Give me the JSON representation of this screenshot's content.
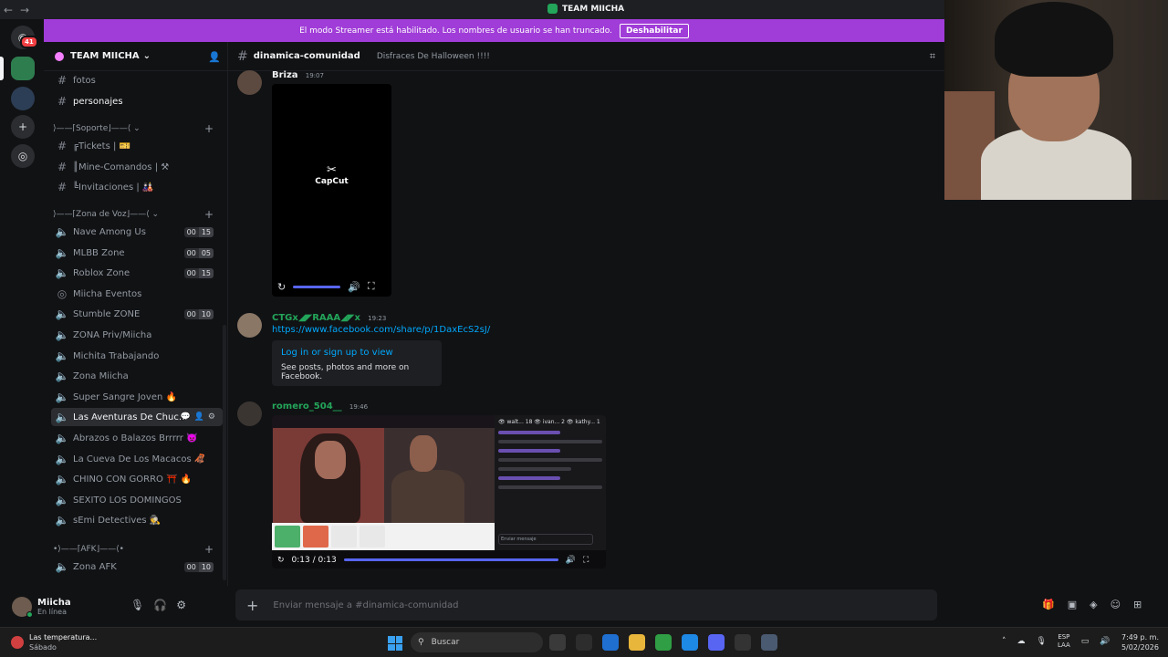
{
  "titlebar": {
    "title": "TEAM MIICHA",
    "back": "←",
    "forward": "→"
  },
  "rail": {
    "badge": "41"
  },
  "banner": {
    "text": "El modo Streamer está habilitado. Los nombres de usuario se han truncado.",
    "button": "Deshabilitar"
  },
  "guild": {
    "name": "TEAM MIICHA"
  },
  "channels": {
    "fotos": "fotos",
    "personajes": "personajes",
    "cat_soporte": "⟩——⌈Soporte⌋——⟨ ⌄",
    "tickets": "╔Tickets | 🎫",
    "mine": "║Mine-Comandos | ⚒",
    "invitaciones": "╚Invitaciones | 🎎",
    "cat_voz": "⟩——⌈Zona de Voz⌋——⟨ ⌄",
    "cat_afk": "•⟩——⌈AFK⌋——⟨•"
  },
  "voice": [
    {
      "name": "Nave Among Us",
      "c1": "00",
      "c2": "15"
    },
    {
      "name": "MLBB Zone",
      "c1": "00",
      "c2": "05"
    },
    {
      "name": "Roblox Zone",
      "c1": "00",
      "c2": "15"
    },
    {
      "name": "Miicha Eventos"
    },
    {
      "name": "Stumble ZONE",
      "c1": "00",
      "c2": "10"
    },
    {
      "name": "ZONA Priv/Miicha"
    },
    {
      "name": "Michita Trabajando"
    },
    {
      "name": "Zona Miicha"
    },
    {
      "name": "Super Sangre Joven 🔥"
    },
    {
      "name": "Las Aventuras De Chuc..."
    },
    {
      "name": "Abrazos o Balazos Brrrrr 👿"
    },
    {
      "name": "La Cueva De Los Macacos 🦧"
    },
    {
      "name": "CHINO CON GORRO ⛩️ 🔥"
    },
    {
      "name": "SEXITO LOS DOMINGOS"
    },
    {
      "name": "sEmi Detectives 🕵️"
    }
  ],
  "afk": {
    "name": "Zona AFK",
    "c1": "00",
    "c2": "10"
  },
  "user": {
    "name": "Miicha",
    "status": "En línea"
  },
  "channel": {
    "name": "dinamica-comunidad",
    "topic": "Disfraces De Halloween !!!!"
  },
  "messages": {
    "m1": {
      "author": "Briza",
      "time": "19:07",
      "logo": "CapCut"
    },
    "m2": {
      "author": "CTGx◢◤RAAA◢◤x",
      "time": "19:23",
      "link": "https://www.facebook.com/share/p/1DaxEcS2sJ/",
      "embed_title": "Log in or sign up to view",
      "embed_desc": "See posts, photos and more on Facebook."
    },
    "m3": {
      "author": "romero_504__",
      "time": "19:46",
      "video_time": "0:13 / 0:13",
      "chat_header": "👁 walt... 18 👁 ivan... 2 👁 kathy... 1",
      "chat_input": "Enviar mensaje"
    }
  },
  "composer": {
    "placeholder": "Enviar mensaje a #dinamica-comunidad"
  },
  "taskbar": {
    "weather_title": "Las temperatura...",
    "weather_sub": "Sábado",
    "weather_badge": "1",
    "search": "Buscar",
    "lang1": "ESP",
    "lang2": "LAA",
    "time": "7:49 p. m.",
    "date": "5/02/2026"
  },
  "colors": {
    "banner": "#a03cd8",
    "accent": "#5865f2",
    "link": "#00a8fc",
    "online": "#23a55a"
  }
}
